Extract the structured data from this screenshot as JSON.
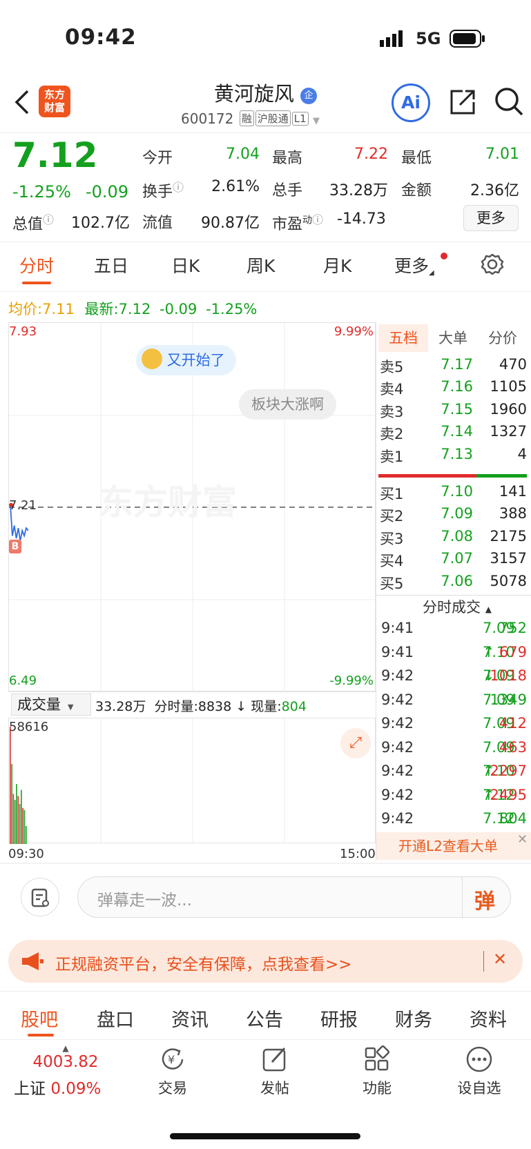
{
  "status": {
    "time": "09:42",
    "network": "5G"
  },
  "header": {
    "logo_line1": "东方",
    "logo_line2": "财富",
    "stock_name": "黄河旋风",
    "name_badge": "企",
    "code": "600172",
    "tags": [
      "融",
      "沪股通",
      "L1"
    ],
    "ai_label": "Ai"
  },
  "quote": {
    "price": "7.12",
    "change_pct": "-1.25%",
    "change": "-0.09",
    "open_label": "今开",
    "open": "7.04",
    "high_label": "最高",
    "high": "7.22",
    "low_label": "最低",
    "low": "7.01",
    "turnover_label": "换手",
    "turnover": "2.61%",
    "volume_label": "总手",
    "volume": "33.28万",
    "amount_label": "金额",
    "amount": "2.36亿",
    "mktcap_label": "总值",
    "mktcap": "102.7亿",
    "float_label": "流值",
    "float": "90.87亿",
    "pe_label": "市盈",
    "pe_sup": "动",
    "pe": "-14.73",
    "more": "更多"
  },
  "tabs": [
    "分时",
    "五日",
    "日K",
    "周K",
    "月K",
    "更多"
  ],
  "summary": {
    "avg_label": "均价:",
    "avg": "7.11",
    "latest_label": "最新:",
    "latest": "7.12",
    "chg": "-0.09",
    "pct": "-1.25%"
  },
  "chart": {
    "y_top": "7.93",
    "y_bottom": "6.49",
    "y_mid": "7.21",
    "pct_top": "9.99%",
    "pct_bottom": "-9.99%",
    "bubble1": "又开始了",
    "bubble2": "板块大涨啊",
    "watermark": "东方财富",
    "b_marker": "B",
    "line_points": [
      7.22,
      7.1,
      7.14,
      7.09,
      7.13,
      7.08,
      7.12,
      7.1,
      7.13,
      7.12
    ]
  },
  "volume": {
    "selector": "成交量",
    "total": "33.28万",
    "minute_label": "分时量:",
    "minute": "8838",
    "current_label": "现量:",
    "current": "804",
    "max": "58616",
    "time_start": "09:30",
    "time_end": "15:00",
    "bars": [
      {
        "v": 58616,
        "c": "red"
      },
      {
        "v": 40000,
        "c": "green"
      },
      {
        "v": 25000,
        "c": "red"
      },
      {
        "v": 22000,
        "c": "green"
      },
      {
        "v": 30000,
        "c": "green"
      },
      {
        "v": 24000,
        "c": "red"
      },
      {
        "v": 20000,
        "c": "green"
      },
      {
        "v": 27000,
        "c": "green"
      },
      {
        "v": 18000,
        "c": "red"
      },
      {
        "v": 17000,
        "c": "green"
      },
      {
        "v": 9000,
        "c": "green"
      }
    ]
  },
  "orderbook": {
    "tabs": [
      "五档",
      "大单",
      "分价"
    ],
    "asks": [
      {
        "label": "卖5",
        "price": "7.17",
        "qty": "470"
      },
      {
        "label": "卖4",
        "price": "7.16",
        "qty": "1105"
      },
      {
        "label": "卖3",
        "price": "7.15",
        "qty": "1960"
      },
      {
        "label": "卖2",
        "price": "7.14",
        "qty": "1327"
      },
      {
        "label": "卖1",
        "price": "7.13",
        "qty": "4"
      }
    ],
    "bids": [
      {
        "label": "买1",
        "price": "7.10",
        "qty": "141"
      },
      {
        "label": "买2",
        "price": "7.09",
        "qty": "388"
      },
      {
        "label": "买3",
        "price": "7.08",
        "qty": "2175"
      },
      {
        "label": "买4",
        "price": "7.07",
        "qty": "3157"
      },
      {
        "label": "买5",
        "price": "7.06",
        "qty": "5078"
      }
    ],
    "ratio_red": 0.66
  },
  "trades": {
    "title": "分时成交",
    "rows": [
      {
        "time": "9:41",
        "price": "7.09",
        "arrow": "",
        "qty": "752",
        "pc": "green",
        "qc": "green"
      },
      {
        "time": "9:41",
        "price": "7.10",
        "arrow": "↑",
        "qty": "679",
        "pc": "green",
        "qc": "red"
      },
      {
        "time": "9:42",
        "price": "7.09",
        "arrow": "↓",
        "qty": "1018",
        "pc": "green",
        "qc": "red"
      },
      {
        "time": "9:42",
        "price": "7.09",
        "arrow": "",
        "qty": "1349",
        "pc": "green",
        "qc": "green"
      },
      {
        "time": "9:42",
        "price": "7.09",
        "arrow": "",
        "qty": "412",
        "pc": "green",
        "qc": "red"
      },
      {
        "time": "9:42",
        "price": "7.09",
        "arrow": "",
        "qty": "463",
        "pc": "green",
        "qc": "red"
      },
      {
        "time": "9:42",
        "price": "7.10",
        "arrow": "↑",
        "qty": "2297",
        "pc": "green",
        "qc": "red"
      },
      {
        "time": "9:42",
        "price": "7.12",
        "arrow": "↑",
        "qty": "2495",
        "pc": "green",
        "qc": "red"
      },
      {
        "time": "9:42",
        "price": "7.12",
        "arrow": "",
        "qty": "804",
        "pc": "green",
        "qc": "green"
      }
    ],
    "l2_banner": "开通L2查看大单"
  },
  "comment": {
    "placeholder": "弹幕走一波...",
    "danmu_button": "弹"
  },
  "promo": {
    "text": "正规融资平台，安全有保障，点我查看>>"
  },
  "bottom_tabs": [
    "股吧",
    "盘口",
    "资讯",
    "公告",
    "研报",
    "财务",
    "资料"
  ],
  "dock": {
    "index_value": "4003.82",
    "index_name": "上证",
    "index_pct": "0.09%",
    "items": [
      "交易",
      "发帖",
      "功能",
      "设自选"
    ]
  }
}
